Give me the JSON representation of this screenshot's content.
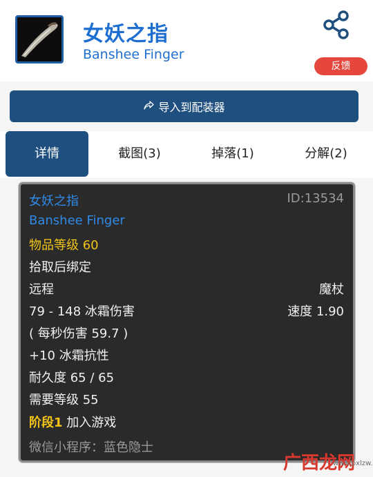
{
  "header": {
    "title_cn": "女妖之指",
    "title_en": "Banshee Finger",
    "feedback_label": "反馈"
  },
  "toolbar": {
    "import_label": "导入到配装器"
  },
  "tabs": [
    {
      "label": "详情",
      "active": true
    },
    {
      "label": "截图(3)",
      "active": false
    },
    {
      "label": "掉落(1)",
      "active": false
    },
    {
      "label": "分解(2)",
      "active": false
    }
  ],
  "tooltip": {
    "name_cn": "女妖之指",
    "id_text": "ID:13534",
    "name_en": "Banshee Finger",
    "item_level": "物品等级 60",
    "bind": "拾取后绑定",
    "slot": "远程",
    "type": "魔杖",
    "damage": "79 - 148 冰霜伤害",
    "speed": "速度 1.90",
    "dps": "( 每秒伤害 59.7 )",
    "resist": "+10 冰霜抗性",
    "durability": "耐久度 65 / 65",
    "required_level": "需要等级 55",
    "phase_label": "阶段1",
    "phase_text": "加入游戏",
    "footer": "微信小程序：蓝色隐士"
  },
  "watermark": {
    "text": "广西龙网",
    "sub": "www.pxlzw.com"
  },
  "colors": {
    "accent": "#1e4f7e",
    "title_blue": "#1f6fd1",
    "feedback_red": "#e5473d",
    "item_blue": "#2f8be8",
    "item_level_yellow": "#f2c319"
  },
  "icons": {
    "item": "wand-item-icon",
    "share": "share-icon",
    "import": "import-arrow-icon"
  }
}
